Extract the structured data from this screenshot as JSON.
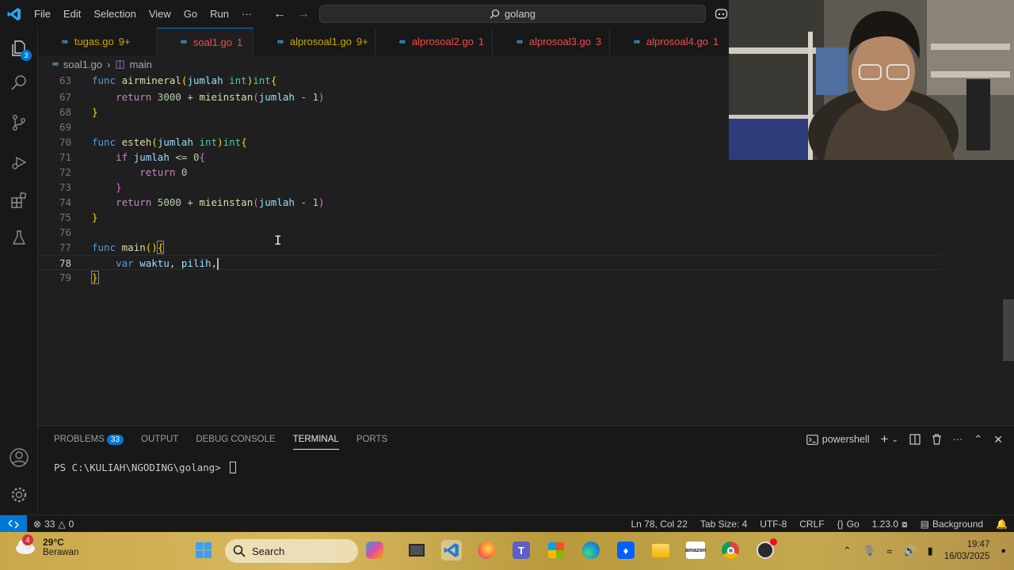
{
  "titlebar": {
    "menu": [
      "File",
      "Edit",
      "Selection",
      "View",
      "Go",
      "Run",
      "···"
    ],
    "search_text": "golang"
  },
  "activity": {
    "explorer_badge": "3"
  },
  "tabs": [
    {
      "name": "tugas.go",
      "count": "9+",
      "state": "warn",
      "dirty": false,
      "active": false
    },
    {
      "name": "soal1.go",
      "count": "1",
      "state": "err",
      "dirty": true,
      "active": true
    },
    {
      "name": "alprosoal1.go",
      "count": "9+",
      "state": "warn",
      "dirty": true,
      "active": false
    },
    {
      "name": "alprosoal2.go",
      "count": "1",
      "state": "err",
      "dirty": false,
      "active": false
    },
    {
      "name": "alprosoal3.go",
      "count": "3",
      "state": "err",
      "dirty": false,
      "active": false
    },
    {
      "name": "alprosoal4.go",
      "count": "1",
      "state": "err",
      "dirty": false,
      "active": false
    }
  ],
  "breadcrumb": {
    "file": "soal1.go",
    "symbol": "main"
  },
  "editor": {
    "line_numbers": [
      "63",
      "67",
      "68",
      "69",
      "70",
      "71",
      "72",
      "73",
      "74",
      "75",
      "76",
      "77",
      "78",
      "79"
    ],
    "current_line": "78"
  },
  "panel": {
    "tabs": [
      "PROBLEMS",
      "OUTPUT",
      "DEBUG CONSOLE",
      "TERMINAL",
      "PORTS"
    ],
    "problems_count": "33",
    "shell": "powershell",
    "prompt": "PS C:\\KULIAH\\NGODING\\golang> "
  },
  "statusbar": {
    "errors": "33",
    "warnings": "0",
    "position": "Ln 78, Col 22",
    "tab_size": "Tab Size: 4",
    "encoding": "UTF-8",
    "eol": "CRLF",
    "language": "Go",
    "version": "1.23.0",
    "background": "Background"
  },
  "taskbar": {
    "weather_badge": "4",
    "temperature": "29°C",
    "condition": "Berawan",
    "search": "Search",
    "time": "19:47",
    "date": "16/03/2025"
  }
}
